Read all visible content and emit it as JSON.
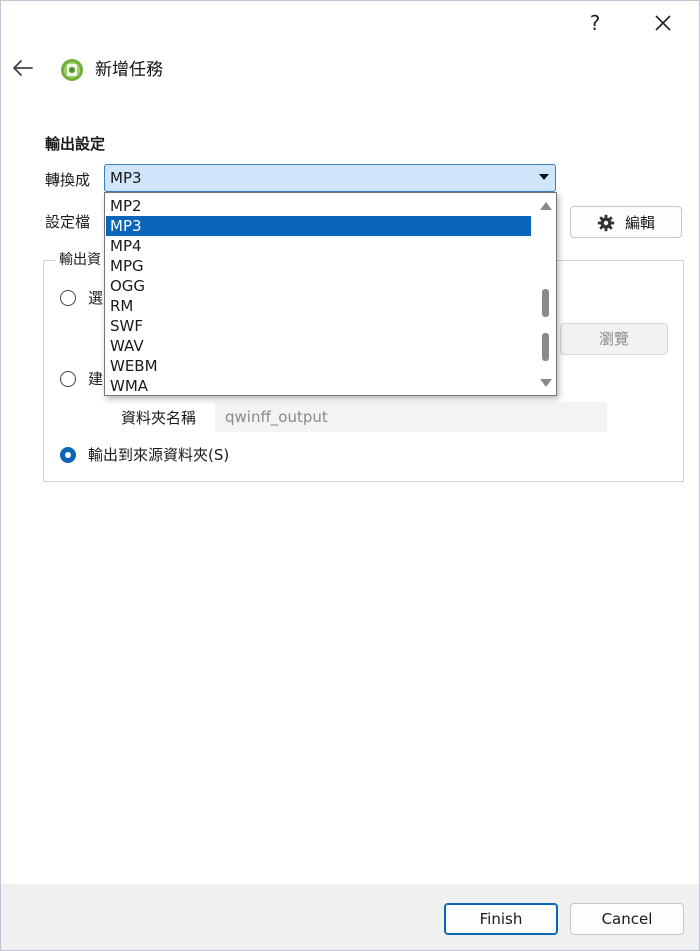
{
  "titlebar": {
    "help_label": "?",
    "close_icon": "close-icon"
  },
  "header": {
    "back_icon": "back-arrow-icon",
    "app_icon": "qwinff-app-icon",
    "title": "新增任務"
  },
  "output_settings": {
    "section_title": "輸出設定",
    "convert_label": "轉換成",
    "selected_format": "MP3",
    "preset_label": "設定檔",
    "edit_button_label": "編輯",
    "edit_icon": "gear-icon"
  },
  "dropdown": {
    "items": [
      "MP2",
      "MP3",
      "MP4",
      "MPG",
      "OGG",
      "RM",
      "SWF",
      "WAV",
      "WEBM",
      "WMA"
    ],
    "selected_index": 1
  },
  "output_folder": {
    "group_title": "輸出資",
    "option_1_label": "選",
    "option_2_label": "建",
    "browse_label": "瀏覽",
    "folder_name_label": "資料夾名稱",
    "folder_name_value": "qwinff_output",
    "option_3_label": "輸出到來源資料夾(S)",
    "selected_option": 3
  },
  "footer": {
    "finish_label": "Finish",
    "cancel_label": "Cancel"
  },
  "colors": {
    "accent": "#0a64b8",
    "combo_bg": "#cfe5f9",
    "footer_bg": "#f0f0f0"
  }
}
